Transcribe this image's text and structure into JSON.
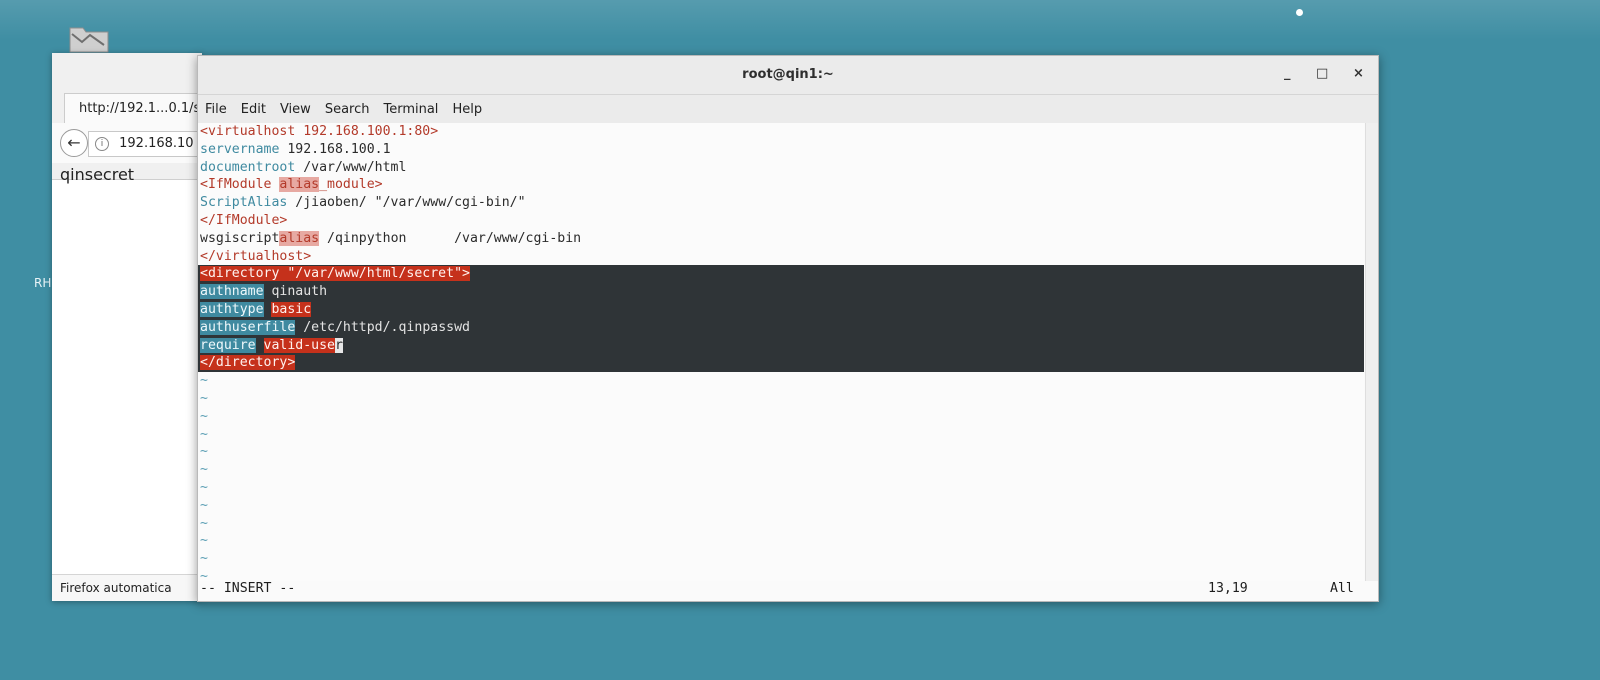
{
  "desktop": {
    "label": "RH"
  },
  "firefox": {
    "tab_title": "http://192.1...0.1/s",
    "url": "192.168.10",
    "content": "qinsecret",
    "status": "Firefox automatica"
  },
  "terminal": {
    "title": "root@qin1:~",
    "controls": {
      "minimize": "_",
      "maximize": "□",
      "close": "×"
    },
    "menu": [
      "File",
      "Edit",
      "View",
      "Search",
      "Terminal",
      "Help"
    ],
    "lines": [
      {
        "parts": [
          {
            "text": "<virtualhost 192.168.100.1:80>",
            "cls": "red"
          }
        ]
      },
      {
        "parts": [
          {
            "text": "servername",
            "cls": "teal"
          },
          {
            "text": " 192.168.100.1",
            "cls": ""
          }
        ]
      },
      {
        "parts": [
          {
            "text": "documentroot",
            "cls": "teal"
          },
          {
            "text": " /var/www/html",
            "cls": ""
          }
        ]
      },
      {
        "parts": [
          {
            "text": "<IfModule ",
            "cls": "red"
          },
          {
            "text": "alias",
            "cls": "search-hl"
          },
          {
            "text": "_module>",
            "cls": "red"
          }
        ]
      },
      {
        "parts": [
          {
            "text": "ScriptAlias",
            "cls": "teal"
          },
          {
            "text": " /jiaoben/ \"/var/www/cgi-bin/\"",
            "cls": ""
          }
        ]
      },
      {
        "parts": [
          {
            "text": "</IfModule>",
            "cls": "red"
          }
        ]
      },
      {
        "parts": [
          {
            "text": "wsgiscript",
            "cls": ""
          },
          {
            "text": "alias",
            "cls": "search-hl"
          },
          {
            "text": " /qinpython      /var/www/cgi-bin",
            "cls": ""
          }
        ]
      },
      {
        "parts": [
          {
            "text": "</virtualhost>",
            "cls": "red"
          }
        ]
      },
      {
        "selected": true,
        "parts": [
          {
            "text": "<directory \"/var/www/html/secret\">",
            "cls": "hl-red"
          }
        ]
      },
      {
        "selected": true,
        "parts": [
          {
            "text": "authname",
            "cls": "hl-teal"
          },
          {
            "text": " qinauth",
            "cls": ""
          }
        ]
      },
      {
        "selected": true,
        "parts": [
          {
            "text": "authtype",
            "cls": "hl-teal"
          },
          {
            "text": " ",
            "cls": ""
          },
          {
            "text": "basic",
            "cls": "hl-red"
          }
        ]
      },
      {
        "selected": true,
        "parts": [
          {
            "text": "authuserfile",
            "cls": "hl-teal"
          },
          {
            "text": " /etc/httpd/.qinpasswd",
            "cls": ""
          }
        ]
      },
      {
        "selected": true,
        "parts": [
          {
            "text": "require",
            "cls": "hl-teal"
          },
          {
            "text": " ",
            "cls": ""
          },
          {
            "text": "valid-use",
            "cls": "hl-red"
          },
          {
            "text": "r",
            "cls": "cursor"
          }
        ]
      },
      {
        "selected": true,
        "parts": [
          {
            "text": "</directory>",
            "cls": "hl-red"
          }
        ]
      }
    ],
    "tilde_lines": [
      "~",
      "~",
      "~",
      "~",
      "~",
      "~",
      "~",
      "~",
      "~",
      "~",
      "~",
      "~"
    ],
    "status": {
      "mode": "-- INSERT --",
      "position": "13,19",
      "scroll": "All"
    }
  }
}
